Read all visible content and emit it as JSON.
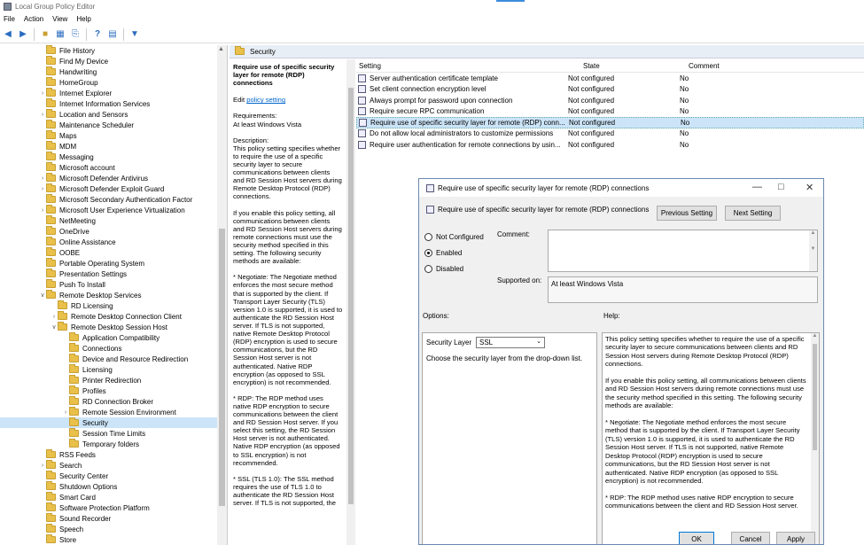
{
  "window": {
    "title": "Local Group Policy Editor"
  },
  "menu": [
    "File",
    "Action",
    "View",
    "Help"
  ],
  "tree": {
    "items": [
      {
        "label": "File History",
        "indent": 1,
        "exp": ""
      },
      {
        "label": "Find My Device",
        "indent": 1,
        "exp": ""
      },
      {
        "label": "Handwriting",
        "indent": 1,
        "exp": ""
      },
      {
        "label": "HomeGroup",
        "indent": 1,
        "exp": ""
      },
      {
        "label": "Internet Explorer",
        "indent": 1,
        "exp": ">"
      },
      {
        "label": "Internet Information Services",
        "indent": 1,
        "exp": ""
      },
      {
        "label": "Location and Sensors",
        "indent": 1,
        "exp": ">"
      },
      {
        "label": "Maintenance Scheduler",
        "indent": 1,
        "exp": ""
      },
      {
        "label": "Maps",
        "indent": 1,
        "exp": ""
      },
      {
        "label": "MDM",
        "indent": 1,
        "exp": ""
      },
      {
        "label": "Messaging",
        "indent": 1,
        "exp": ""
      },
      {
        "label": "Microsoft account",
        "indent": 1,
        "exp": ""
      },
      {
        "label": "Microsoft Defender Antivirus",
        "indent": 1,
        "exp": ">"
      },
      {
        "label": "Microsoft Defender Exploit Guard",
        "indent": 1,
        "exp": ">"
      },
      {
        "label": "Microsoft Secondary Authentication Factor",
        "indent": 1,
        "exp": ""
      },
      {
        "label": "Microsoft User Experience Virtualization",
        "indent": 1,
        "exp": ">"
      },
      {
        "label": "NetMeeting",
        "indent": 1,
        "exp": ""
      },
      {
        "label": "OneDrive",
        "indent": 1,
        "exp": ""
      },
      {
        "label": "Online Assistance",
        "indent": 1,
        "exp": ""
      },
      {
        "label": "OOBE",
        "indent": 1,
        "exp": ""
      },
      {
        "label": "Portable Operating System",
        "indent": 1,
        "exp": ""
      },
      {
        "label": "Presentation Settings",
        "indent": 1,
        "exp": ""
      },
      {
        "label": "Push To Install",
        "indent": 1,
        "exp": ""
      },
      {
        "label": "Remote Desktop Services",
        "indent": 1,
        "exp": "v"
      },
      {
        "label": "RD Licensing",
        "indent": 2,
        "exp": ""
      },
      {
        "label": "Remote Desktop Connection Client",
        "indent": 2,
        "exp": ">"
      },
      {
        "label": "Remote Desktop Session Host",
        "indent": 2,
        "exp": "v"
      },
      {
        "label": "Application Compatibility",
        "indent": 3,
        "exp": ""
      },
      {
        "label": "Connections",
        "indent": 3,
        "exp": ""
      },
      {
        "label": "Device and Resource Redirection",
        "indent": 3,
        "exp": ""
      },
      {
        "label": "Licensing",
        "indent": 3,
        "exp": ""
      },
      {
        "label": "Printer Redirection",
        "indent": 3,
        "exp": ""
      },
      {
        "label": "Profiles",
        "indent": 3,
        "exp": ""
      },
      {
        "label": "RD Connection Broker",
        "indent": 3,
        "exp": ""
      },
      {
        "label": "Remote Session Environment",
        "indent": 3,
        "exp": ">"
      },
      {
        "label": "Security",
        "indent": 3,
        "exp": "",
        "selected": true
      },
      {
        "label": "Session Time Limits",
        "indent": 3,
        "exp": ""
      },
      {
        "label": "Temporary folders",
        "indent": 3,
        "exp": ""
      },
      {
        "label": "RSS Feeds",
        "indent": 1,
        "exp": ""
      },
      {
        "label": "Search",
        "indent": 1,
        "exp": ">"
      },
      {
        "label": "Security Center",
        "indent": 1,
        "exp": ""
      },
      {
        "label": "Shutdown Options",
        "indent": 1,
        "exp": ""
      },
      {
        "label": "Smart Card",
        "indent": 1,
        "exp": ""
      },
      {
        "label": "Software Protection Platform",
        "indent": 1,
        "exp": ""
      },
      {
        "label": "Sound Recorder",
        "indent": 1,
        "exp": ""
      },
      {
        "label": "Speech",
        "indent": 1,
        "exp": ""
      },
      {
        "label": "Store",
        "indent": 1,
        "exp": ""
      }
    ]
  },
  "right_header": "Security",
  "desc": {
    "title": "Require use of specific security layer for remote (RDP) connections",
    "edit_prefix": "Edit",
    "edit_link": "policy setting",
    "requirements_label": "Requirements:",
    "requirements": "At least Windows Vista",
    "description_label": "Description:",
    "paragraphs": [
      "This policy setting specifies whether to require the use of a specific security layer to secure communications between clients and RD Session Host servers during Remote Desktop Protocol (RDP) connections.",
      "If you enable this policy setting, all communications between clients and RD Session Host servers during remote connections must use the security method specified in this setting. The following security methods are available:",
      "* Negotiate: The Negotiate method enforces the most secure method that is supported by the client. If Transport Layer Security (TLS) version 1.0 is supported, it is used to authenticate the RD Session Host server. If TLS is not supported, native Remote Desktop Protocol (RDP) encryption is used to secure communications, but the RD Session Host server is not authenticated. Native RDP encryption (as opposed to SSL encryption) is not recommended.",
      "* RDP: The RDP method uses native RDP encryption to secure communications between the client and RD Session Host server. If you select this setting, the RD Session Host server is not authenticated. Native RDP encryption (as opposed to SSL encryption) is not recommended.",
      "* SSL (TLS 1.0): The SSL method requires the use of TLS 1.0 to authenticate the RD Session Host server. If TLS is not supported, the"
    ]
  },
  "list": {
    "headers": [
      "Setting",
      "State",
      "Comment"
    ],
    "rows": [
      {
        "setting": "Server authentication certificate template",
        "state": "Not configured",
        "comment": "No"
      },
      {
        "setting": "Set client connection encryption level",
        "state": "Not configured",
        "comment": "No"
      },
      {
        "setting": "Always prompt for password upon connection",
        "state": "Not configured",
        "comment": "No"
      },
      {
        "setting": "Require secure RPC communication",
        "state": "Not configured",
        "comment": "No"
      },
      {
        "setting": "Require use of specific security layer for remote (RDP) conn...",
        "state": "Not configured",
        "comment": "No",
        "selected": true
      },
      {
        "setting": "Do not allow local administrators to customize permissions",
        "state": "Not configured",
        "comment": "No"
      },
      {
        "setting": "Require user authentication for remote connections by usin...",
        "state": "Not configured",
        "comment": "No"
      }
    ]
  },
  "dialog": {
    "title": "Require use of specific security layer for remote (RDP) connections",
    "subtitle": "Require use of specific security layer for remote (RDP) connections",
    "prev_button": "Previous Setting",
    "next_button": "Next Setting",
    "radios": [
      "Not Configured",
      "Enabled",
      "Disabled"
    ],
    "selected_radio": "Enabled",
    "comment_label": "Comment:",
    "supported_label": "Supported on:",
    "supported_value": "At least Windows Vista",
    "options_label": "Options:",
    "help_label": "Help:",
    "security_layer_label": "Security Layer",
    "security_layer_value": "SSL",
    "security_layer_hint": "Choose the security layer from the drop-down list.",
    "help_paragraphs": [
      "This policy setting specifies whether to require the use of a specific security layer to secure communications between clients and RD Session Host servers during Remote Desktop Protocol (RDP) connections.",
      "If you enable this policy setting, all communications between clients and RD Session Host servers during remote connections must use the security method specified in this setting. The following security methods are available:",
      "* Negotiate: The Negotiate method enforces the most secure method that is supported by the client. If Transport Layer Security (TLS) version 1.0 is supported, it is used to authenticate the RD Session Host server. If TLS is not supported, native Remote Desktop Protocol (RDP) encryption is used to secure communications, but the RD Session Host server is not authenticated. Native RDP encryption (as opposed to SSL encryption) is not recommended.",
      "* RDP: The RDP method uses native RDP encryption to secure communications between the client and RD Session Host server."
    ],
    "ok_button": "OK",
    "cancel_button": "Cancel",
    "apply_button": "Apply"
  }
}
